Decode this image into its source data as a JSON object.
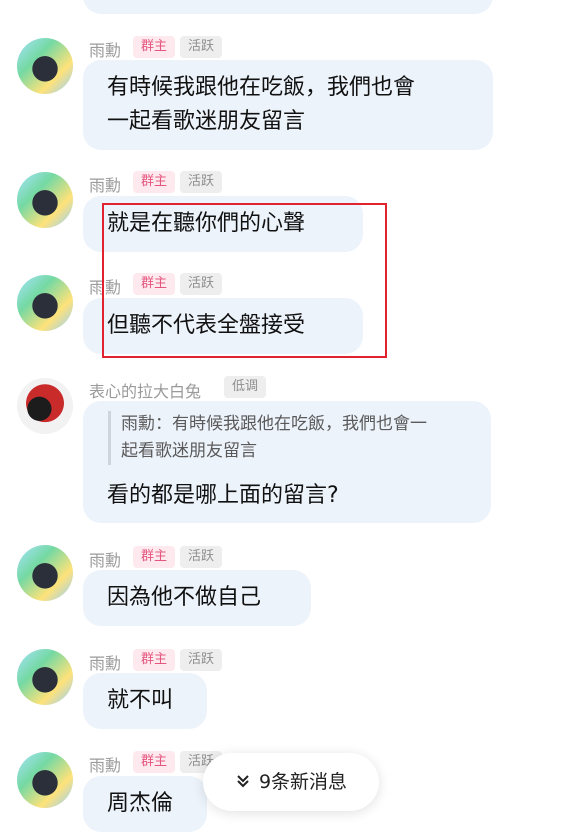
{
  "messages": [
    {
      "sender": "雨勳",
      "badges": [
        "群主",
        "活跃"
      ],
      "text_lines": [
        "有時候我跟他在吃飯，我們也會",
        "一起看歌迷朋友留言"
      ]
    },
    {
      "sender": "雨勳",
      "badges": [
        "群主",
        "活跃"
      ],
      "text_lines": [
        "就是在聽你們的心聲"
      ]
    },
    {
      "sender": "雨勳",
      "badges": [
        "群主",
        "活跃"
      ],
      "text_lines": [
        "但聽不代表全盤接受"
      ]
    },
    {
      "sender": "表心的拉大白兔",
      "badges": [
        "低调"
      ],
      "quote_lines": [
        "雨勳：有時候我跟他在吃飯，我們也會一",
        "起看歌迷朋友留言"
      ],
      "text_lines": [
        "看的都是哪上面的留言?"
      ]
    },
    {
      "sender": "雨勳",
      "badges": [
        "群主",
        "活跃"
      ],
      "text_lines": [
        "因為他不做自己"
      ]
    },
    {
      "sender": "雨勳",
      "badges": [
        "群主",
        "活跃"
      ],
      "text_lines": [
        "就不叫"
      ]
    },
    {
      "sender": "雨勳",
      "badges": [
        "群主",
        "活跃"
      ],
      "text_lines": [
        "周杰倫"
      ]
    }
  ],
  "new_messages": {
    "label": "9条新消息",
    "icon": "double-chevron-down-icon"
  },
  "colors": {
    "bubble": "#edf3fb",
    "owner_badge": "#e5567f",
    "highlight_box": "#e0232f"
  }
}
